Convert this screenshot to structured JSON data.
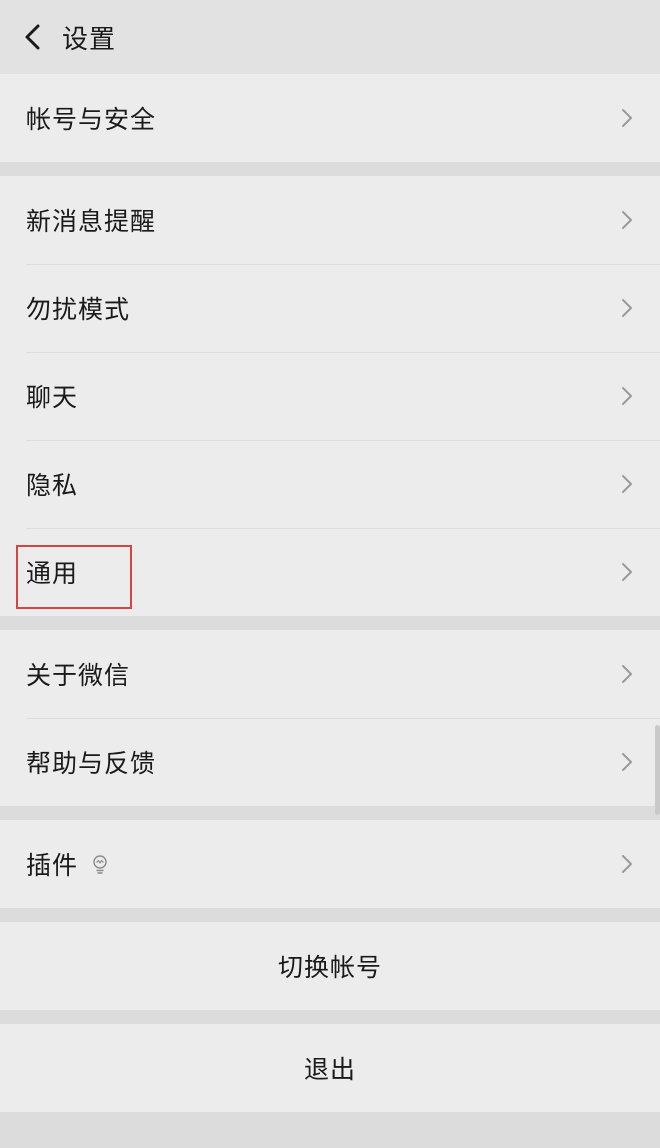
{
  "header": {
    "title": "设置"
  },
  "groups": [
    {
      "items": [
        {
          "label": "帐号与安全"
        }
      ]
    },
    {
      "items": [
        {
          "label": "新消息提醒"
        },
        {
          "label": "勿扰模式"
        },
        {
          "label": "聊天"
        },
        {
          "label": "隐私"
        },
        {
          "label": "通用"
        }
      ]
    },
    {
      "items": [
        {
          "label": "关于微信"
        },
        {
          "label": "帮助与反馈"
        }
      ]
    },
    {
      "items": [
        {
          "label": "插件",
          "icon": "bulb-icon"
        }
      ]
    }
  ],
  "actions": {
    "switch_account": "切换帐号",
    "logout": "退出"
  },
  "icons": {
    "back": "chevron-left-icon",
    "disclosure": "chevron-right-icon",
    "plugin": "bulb-icon"
  },
  "colors": {
    "background": "#dcdcdc",
    "row": "#ececec",
    "highlight": "#d64541"
  }
}
